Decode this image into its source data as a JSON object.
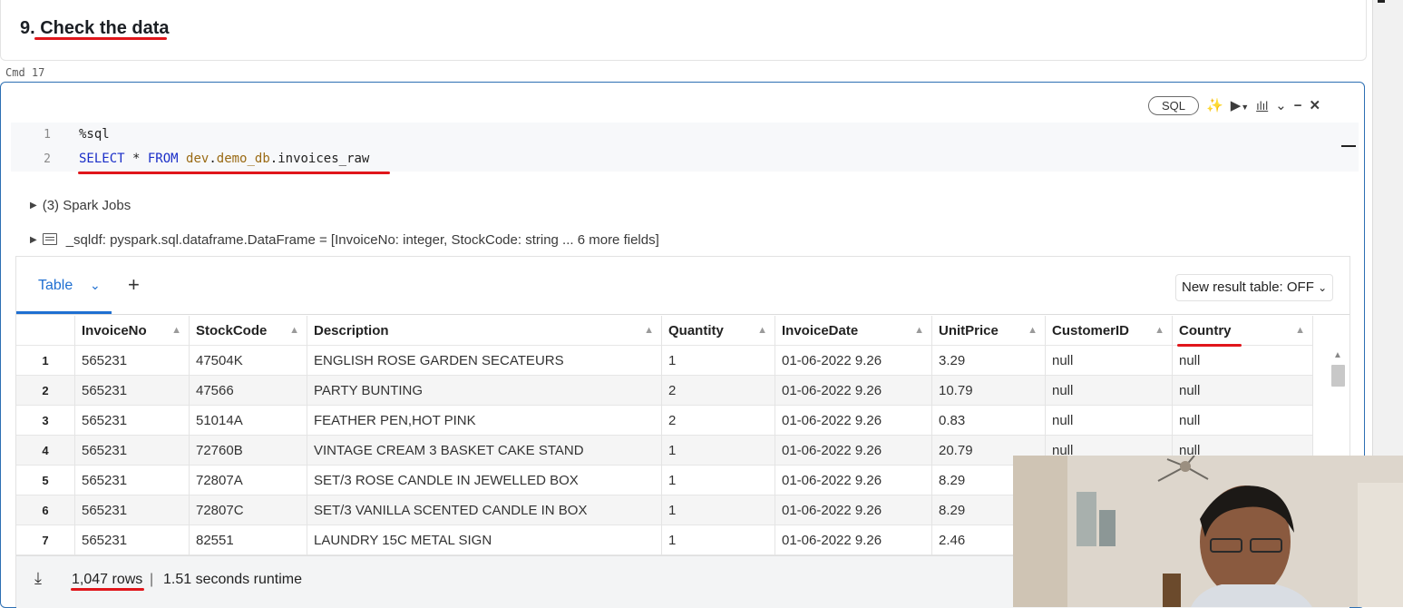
{
  "markdown": {
    "heading": "9. Check the data"
  },
  "cmd_label": "Cmd 17",
  "cell": {
    "language_badge": "SQL",
    "toolbar_icons": [
      "sparkle-icon",
      "run-icon",
      "chart-icon",
      "collapse-icon",
      "minimize-icon",
      "close-icon"
    ],
    "code_lines": [
      {
        "no": "1",
        "text": "%sql"
      },
      {
        "no": "2",
        "kw1": "SELECT",
        "mid1": " * ",
        "kw2": "FROM",
        "sp": " ",
        "ns1": "dev",
        "dot1": ".",
        "ns2": "demo_db",
        "dot2": ".",
        "tbl": "invoices_raw"
      }
    ]
  },
  "output": {
    "spark_jobs": "(3) Spark Jobs",
    "sqldf": "_sqldf:  pyspark.sql.dataframe.DataFrame = [InvoiceNo: integer, StockCode: string ... 6 more fields]"
  },
  "results": {
    "tab_label": "Table",
    "new_result_toggle": "New result table: OFF",
    "columns": [
      "InvoiceNo",
      "StockCode",
      "Description",
      "Quantity",
      "InvoiceDate",
      "UnitPrice",
      "CustomerID",
      "Country"
    ],
    "rows": [
      [
        "1",
        "565231",
        "47504K",
        "ENGLISH ROSE GARDEN SECATEURS",
        "1",
        "01-06-2022 9.26",
        "3.29",
        "null",
        "null"
      ],
      [
        "2",
        "565231",
        "47566",
        "PARTY BUNTING",
        "2",
        "01-06-2022 9.26",
        "10.79",
        "null",
        "null"
      ],
      [
        "3",
        "565231",
        "51014A",
        "FEATHER PEN,HOT PINK",
        "2",
        "01-06-2022 9.26",
        "0.83",
        "null",
        "null"
      ],
      [
        "4",
        "565231",
        "72760B",
        "VINTAGE CREAM 3 BASKET CAKE STAND",
        "1",
        "01-06-2022 9.26",
        "20.79",
        "null",
        "null"
      ],
      [
        "5",
        "565231",
        "72807A",
        "SET/3 ROSE CANDLE IN JEWELLED BOX",
        "1",
        "01-06-2022 9.26",
        "8.29",
        "",
        ""
      ],
      [
        "6",
        "565231",
        "72807C",
        "SET/3 VANILLA SCENTED CANDLE IN BOX",
        "1",
        "01-06-2022 9.26",
        "8.29",
        "",
        ""
      ],
      [
        "7",
        "565231",
        "82551",
        "LAUNDRY 15C METAL SIGN",
        "1",
        "01-06-2022 9.26",
        "2.46",
        "",
        ""
      ]
    ],
    "row_count": "1,047 rows",
    "separator": "|",
    "runtime": "1.51 seconds runtime"
  }
}
